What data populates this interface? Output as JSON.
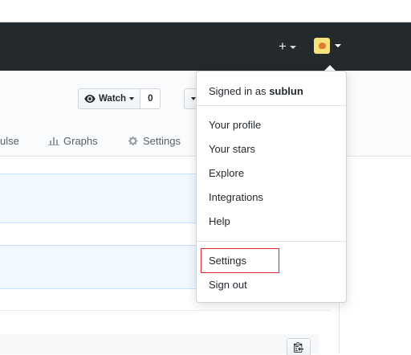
{
  "header": {
    "plus_label": "+",
    "avatar_alt": "sublun avatar"
  },
  "repo": {
    "watch_label": "Watch",
    "watch_count": "0",
    "tabs": [
      {
        "label": "ulse",
        "icon": "pulse-icon"
      },
      {
        "label": "Graphs",
        "icon": "graph-icon"
      },
      {
        "label": "Settings",
        "icon": "gear-icon"
      }
    ]
  },
  "dropdown": {
    "signed_in_prefix": "Signed in as",
    "username": "sublun",
    "items": [
      {
        "label": "Your profile"
      },
      {
        "label": "Your stars"
      },
      {
        "label": "Explore"
      },
      {
        "label": "Integrations"
      },
      {
        "label": "Help"
      },
      {
        "label": "Settings"
      },
      {
        "label": "Sign out"
      }
    ]
  },
  "colors": {
    "topbar": "#24292e",
    "highlight": "#e8262f",
    "info_box": "#f1f8ff"
  }
}
